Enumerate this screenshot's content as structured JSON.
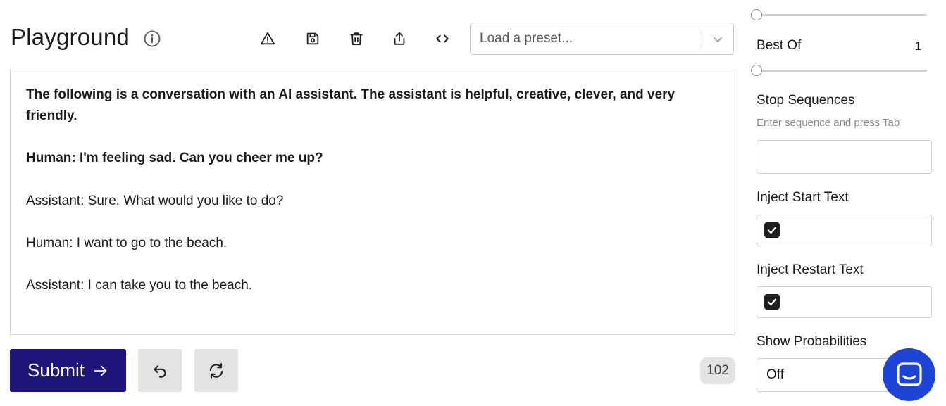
{
  "header": {
    "title": "Playground",
    "icons": [
      "info-icon",
      "warning-icon",
      "save-icon",
      "trash-icon",
      "share-icon",
      "code-icon"
    ]
  },
  "preset": {
    "placeholder": "Load a preset..."
  },
  "editor": {
    "lines": [
      "The following is a conversation with an AI assistant. The assistant is helpful, creative, clever, and very",
      "friendly.",
      "Human: I'm feeling sad. Can you cheer me up?",
      "Assistant: Sure. What would you like to do?",
      "Human: I want to go to the beach.",
      "Assistant: I can take you to the beach."
    ]
  },
  "actions": {
    "submit_label": "Submit",
    "token_count": "102"
  },
  "sidebar": {
    "best_of": {
      "label": "Best Of",
      "value": "1"
    },
    "stop_sequences": {
      "label": "Stop Sequences",
      "hint": "Enter sequence and press Tab",
      "value": ""
    },
    "inject_start_text": {
      "label": "Inject Start Text",
      "checked": true
    },
    "inject_restart_text": {
      "label": "Inject Restart Text",
      "checked": true
    },
    "show_probabilities": {
      "label": "Show Probabilities",
      "value": "Off"
    }
  },
  "colors": {
    "submit_bg": "#1e1578",
    "chat_launcher_bg": "#1e44d6",
    "button_gray": "#e3e3e3"
  }
}
